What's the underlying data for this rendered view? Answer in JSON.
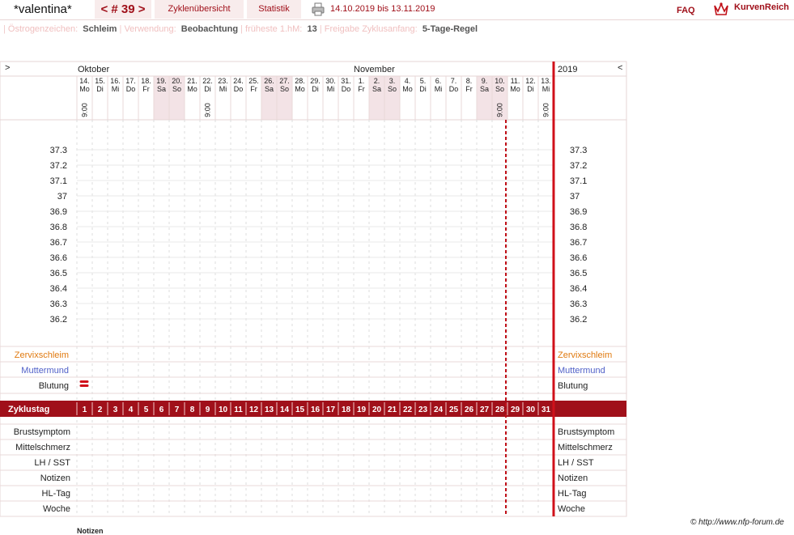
{
  "header": {
    "title": "*valentina*",
    "cycle_label": "< # 39 >",
    "overview_label": "Zyklenübersicht",
    "stats_label": "Statistik",
    "date_range": "14.10.2019 bis 13.11.2019",
    "faq_label": "FAQ",
    "logo_text": "KurvenReich"
  },
  "meta": [
    {
      "label": "Östrogenzeichen:",
      "value": "Schleim"
    },
    {
      "label": "Verwendung:",
      "value": "Beobachtung"
    },
    {
      "label": "früheste 1.hM:",
      "value": "13"
    },
    {
      "label": "Freigabe Zyklusanfang:",
      "value": "5-Tage-Regel"
    }
  ],
  "nav": {
    "left_arrow": ">",
    "right_arrow": "<"
  },
  "calendar": {
    "months": [
      {
        "name": "Oktober",
        "start_index": 0
      },
      {
        "name": "November",
        "start_index": 18
      }
    ],
    "year": "2019",
    "days": [
      {
        "d": "14.",
        "w": "Mo",
        "time": "9:00"
      },
      {
        "d": "15.",
        "w": "Di"
      },
      {
        "d": "16.",
        "w": "Mi"
      },
      {
        "d": "17.",
        "w": "Do"
      },
      {
        "d": "18.",
        "w": "Fr"
      },
      {
        "d": "19.",
        "w": "Sa",
        "weekend": true
      },
      {
        "d": "20.",
        "w": "So",
        "weekend": true
      },
      {
        "d": "21.",
        "w": "Mo"
      },
      {
        "d": "22.",
        "w": "Di",
        "time": "9:00"
      },
      {
        "d": "23.",
        "w": "Mi"
      },
      {
        "d": "24.",
        "w": "Do"
      },
      {
        "d": "25.",
        "w": "Fr"
      },
      {
        "d": "26.",
        "w": "Sa",
        "weekend": true
      },
      {
        "d": "27.",
        "w": "So",
        "weekend": true
      },
      {
        "d": "28.",
        "w": "Mo"
      },
      {
        "d": "29.",
        "w": "Di"
      },
      {
        "d": "30.",
        "w": "Mi"
      },
      {
        "d": "31.",
        "w": "Do"
      },
      {
        "d": "1.",
        "w": "Fr"
      },
      {
        "d": "2.",
        "w": "Sa",
        "weekend": true
      },
      {
        "d": "3.",
        "w": "So",
        "weekend": true
      },
      {
        "d": "4.",
        "w": "Mo"
      },
      {
        "d": "5.",
        "w": "Di"
      },
      {
        "d": "6.",
        "w": "Mi"
      },
      {
        "d": "7.",
        "w": "Do"
      },
      {
        "d": "8.",
        "w": "Fr"
      },
      {
        "d": "9.",
        "w": "Sa",
        "weekend": true
      },
      {
        "d": "10.",
        "w": "So",
        "weekend": true,
        "time": "9:00"
      },
      {
        "d": "11.",
        "w": "Mo"
      },
      {
        "d": "12.",
        "w": "Di"
      },
      {
        "d": "13.",
        "w": "Mi",
        "time": "9:00"
      }
    ],
    "cycle_days": [
      "1",
      "2",
      "3",
      "4",
      "5",
      "6",
      "7",
      "8",
      "9",
      "10",
      "11",
      "12",
      "13",
      "14",
      "15",
      "16",
      "17",
      "18",
      "19",
      "20",
      "21",
      "22",
      "23",
      "24",
      "25",
      "26",
      "27",
      "28",
      "29",
      "30",
      "31"
    ],
    "dashed_marker_after_day": 28
  },
  "temperature_labels": [
    "37.3",
    "37.2",
    "37.1",
    "37",
    "36.9",
    "36.8",
    "36.7",
    "36.6",
    "36.5",
    "36.4",
    "36.3",
    "36.2"
  ],
  "rows_upper": [
    {
      "label": "Zervixschleim",
      "color": "#e07a10"
    },
    {
      "label": "Muttermund",
      "color": "#5060c8"
    },
    {
      "label": "Blutung",
      "color": "#222222"
    }
  ],
  "bleeding_day_index": 0,
  "cycle_row_label": "Zyklustag",
  "rows_lower": [
    "Brustsymptom",
    "Mittelschmerz",
    "LH / SST",
    "Notizen",
    "HL-Tag",
    "Woche"
  ],
  "footer": "© http://www.nfp-forum.de",
  "notes_heading": "Notizen",
  "colors": {
    "accent": "#a0101a",
    "weekend": "#f3e3e6",
    "panel": "#faf4f4"
  }
}
